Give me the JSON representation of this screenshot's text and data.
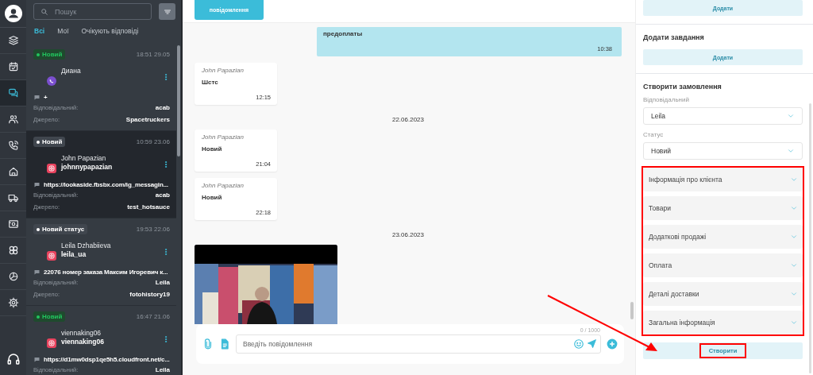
{
  "nav_items": [
    {
      "selected": false
    },
    {
      "selected": false
    },
    {
      "selected": true
    },
    {
      "selected": false
    },
    {
      "selected": false
    },
    {
      "selected": false
    },
    {
      "selected": false
    },
    {
      "selected": false
    },
    {
      "selected": false
    },
    {
      "selected": false
    },
    {
      "selected": false
    }
  ],
  "search": {
    "placeholder": "Пошук"
  },
  "filters": [
    {
      "label": "Всі",
      "selected": true
    },
    {
      "label": "Мої",
      "selected": false
    },
    {
      "label": "Очікують відповіді",
      "selected": false
    }
  ],
  "conversations": [
    {
      "status": "Новий",
      "color": "#22c55e",
      "time": "18:51 29.05",
      "name": "Диана",
      "kind": "viber",
      "preview": "+",
      "responsible_label": "Відповідальний:",
      "responsible": "acab",
      "source_label": "Джерело:",
      "source": "Spacetruckers",
      "selected": false
    },
    {
      "status": "Новий",
      "color": "#ffffff",
      "time": "10:59 23.06",
      "name": "John Papazian",
      "username": "johnnypapazian",
      "kind": "instagram",
      "preview": "https://lookaside.fbsbx.com/ig_messagin...",
      "responsible_label": "Відповідальний:",
      "responsible": "acab",
      "source_label": "Джерело:",
      "source": "test_hotsauce",
      "selected": true
    },
    {
      "status": "Новий статус",
      "color": "#ffffff",
      "time": "19:53 22.06",
      "name": "Leila Dzhabiieva",
      "username": "leila_ua",
      "kind": "instagram",
      "preview": "22076 номер заказа Максим Игоревич к...",
      "responsible_label": "Відповідальний:",
      "responsible": "Leila",
      "source_label": "Джерело:",
      "source": "fotohistory19",
      "selected": false
    },
    {
      "status": "Новий",
      "color": "#22c55e",
      "time": "16:47 21.06",
      "name": "viennaking06",
      "username": "viennaking06",
      "kind": "instagram",
      "preview": "https://d1mw0dsp1qe5h5.cloudfront.net/c...",
      "responsible_label": "Відповідальний:",
      "responsible": "Leila",
      "selected": false
    }
  ],
  "chat": {
    "header_button": "повідомлення",
    "messages": [
      {
        "kind": "outgoing",
        "text": "предоплаты",
        "time": "10:38"
      },
      {
        "kind": "incoming",
        "author": "John Papazian",
        "text": "Шстс",
        "time": "12:15"
      },
      {
        "kind": "date",
        "text": "22.06.2023"
      },
      {
        "kind": "incoming",
        "author": "John Papazian",
        "text": "Новий",
        "time": "21:04"
      },
      {
        "kind": "incoming",
        "author": "John Papazian",
        "text": "Новий",
        "time": "22:18"
      },
      {
        "kind": "date",
        "text": "23.06.2023"
      },
      {
        "kind": "picture"
      }
    ],
    "counter": "0 / 1000",
    "placeholder": "Введіть повідомлення"
  },
  "panel": {
    "top_button": "Додати",
    "task_title": "Додати завдання",
    "task_button": "Додати",
    "order": {
      "title": "Створити замовлення",
      "responsible_label": "Відповідальний",
      "responsible": "Leila",
      "status_label": "Статус",
      "status": "Новий",
      "sections": {
        "highlighted": true,
        "items": [
          {
            "label": "Інформація про клієнта"
          },
          {
            "label": "Товари"
          },
          {
            "label": "Додаткові продажі"
          },
          {
            "label": "Оплата"
          },
          {
            "label": "Деталі доставки"
          },
          {
            "label": "Загальна інформація"
          }
        ]
      },
      "create_button": {
        "label": "Створити",
        "highlighted": true
      }
    }
  },
  "annotation_arrow": true
}
